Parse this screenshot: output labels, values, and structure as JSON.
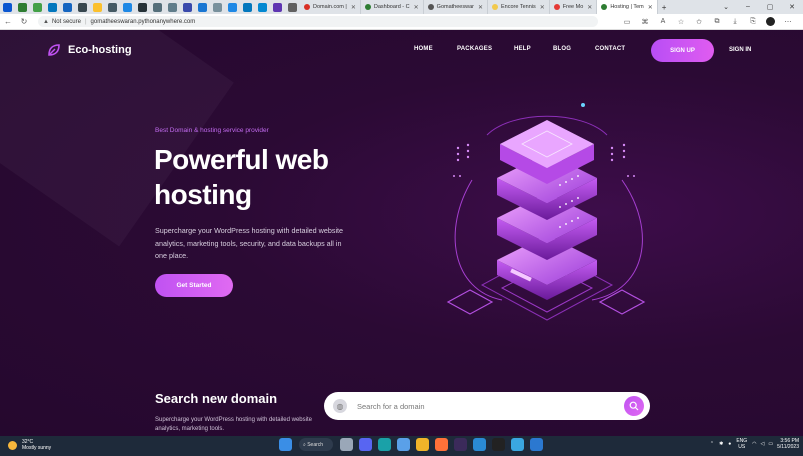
{
  "browser": {
    "tabs": [
      {
        "label": "Domain.com |",
        "color": "#d93025",
        "active": false
      },
      {
        "label": "Dashboard - C",
        "color": "#2e7d32",
        "active": false
      },
      {
        "label": "Gomatheeswar",
        "color": "#555555",
        "active": false
      },
      {
        "label": "Encore Tennis",
        "color": "#f2c94c",
        "active": false
      },
      {
        "label": "Free Mo",
        "color": "#e53935",
        "active": false
      },
      {
        "label": "Hosting | Tem",
        "color": "#2e7d32",
        "active": true
      }
    ],
    "address": {
      "security_label": "Not secure",
      "url": "gomatheeswaran.pythonanywhere.com"
    }
  },
  "site": {
    "brand": "Eco-hosting",
    "nav": [
      {
        "label": "HOME"
      },
      {
        "label": "PACKAGES"
      },
      {
        "label": "HELP"
      },
      {
        "label": "BLOG"
      },
      {
        "label": "CONTACT"
      }
    ],
    "signup_label": "SIGN UP",
    "signin_label": "SIGN IN",
    "hero": {
      "tagline": "Best Domain & hosting service provider",
      "title": "Powerful web hosting",
      "description": "Supercharge your WordPress hosting with detailed website analytics, marketing tools, security, and data backups all in one place.",
      "cta_label": "Get Started"
    },
    "domain_search": {
      "title": "Search new domain",
      "description": "Supercharge your WordPress hosting with detailed website analytics, marketing tools.",
      "placeholder": "Search for a domain"
    },
    "colors": {
      "accent": "#c052f2",
      "background": "#2a0a33"
    }
  },
  "taskbar": {
    "weather_temp": "32°C",
    "weather_desc": "Mostly sunny",
    "search_label": "Search",
    "lang_line1": "ENG",
    "lang_line2": "US",
    "time": "3:56 PM",
    "date": "5/11/2023"
  }
}
